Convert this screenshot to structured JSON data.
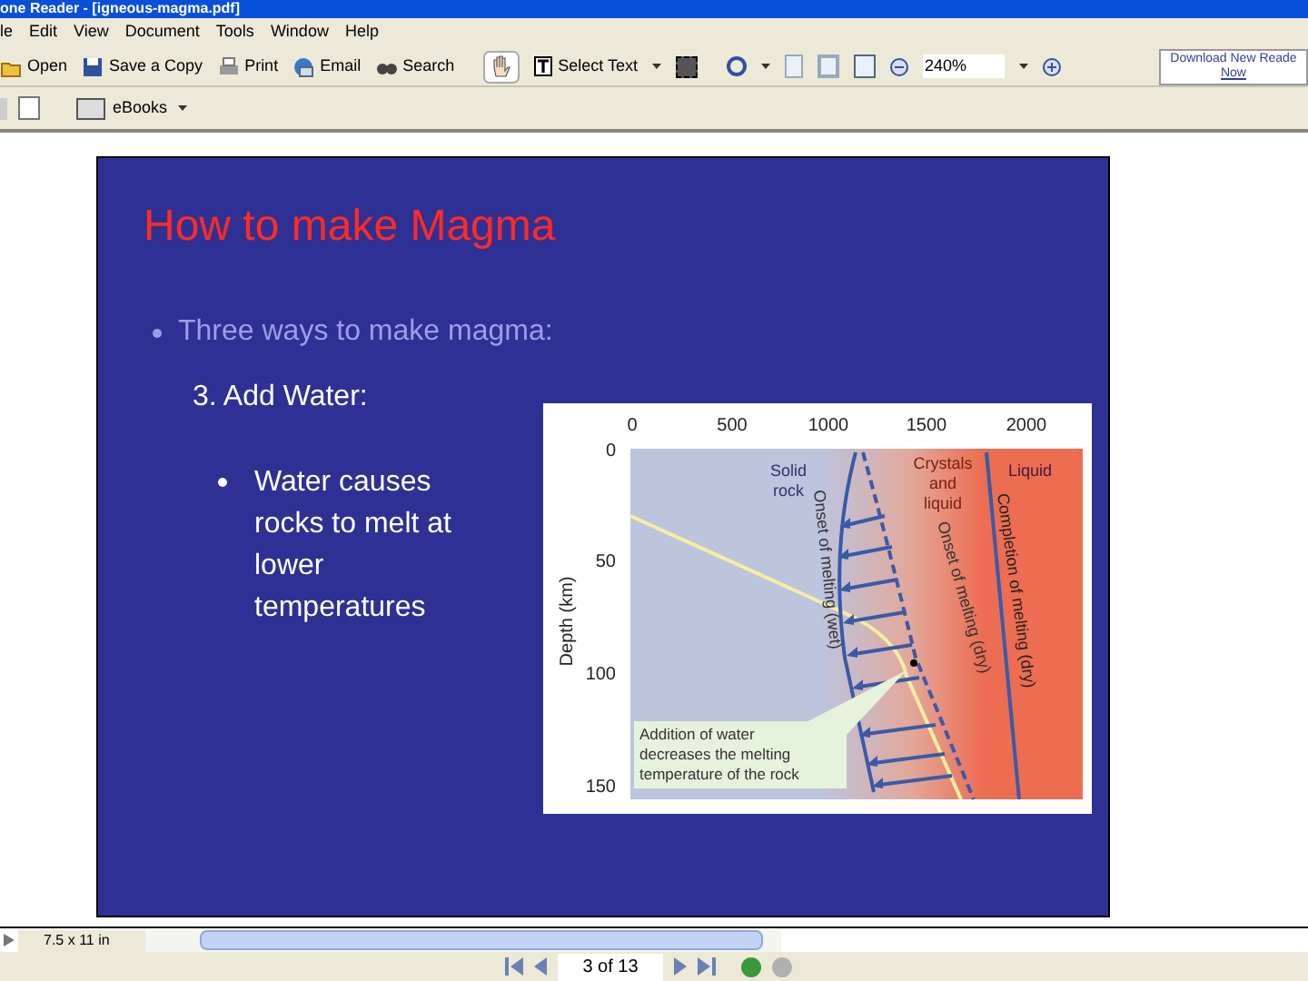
{
  "window": {
    "title": "one Reader - [igneous-magma.pdf]"
  },
  "menu": [
    "le",
    "Edit",
    "View",
    "Document",
    "Tools",
    "Window",
    "Help"
  ],
  "toolbar": {
    "buttons": [
      {
        "kind": "open",
        "label": "Open"
      },
      {
        "kind": "save",
        "label": "Save a Copy"
      },
      {
        "kind": "print",
        "label": "Print"
      },
      {
        "kind": "email",
        "label": "Email"
      },
      {
        "kind": "search",
        "label": "Search"
      }
    ],
    "select_text": "Select Text",
    "zoom": "240%",
    "promo": [
      "Download New Reade",
      "Now"
    ],
    "ebooks": "eBooks"
  },
  "slide": {
    "title": "How to make Magma",
    "bullet": "Three ways to make magma:",
    "subheading": "3. Add Water:",
    "sub_bullet": "Water causes rocks to melt at lower temperatures",
    "figure": {
      "x_ticks": [
        "0",
        "500",
        "1000",
        "1500",
        "2000"
      ],
      "y_ticks": [
        "0",
        "50",
        "100",
        "150"
      ],
      "y_label": "Depth (km)",
      "regions": [
        [
          "Solid",
          "rock"
        ],
        [
          "Crystals",
          "and",
          "liquid"
        ],
        [
          "Liquid"
        ]
      ],
      "curves": [
        "Onset of melting (wet)",
        "Onset of melting (dry)",
        "Completion of melting (dry)"
      ],
      "callout": [
        "Addition of water",
        "decreases the melting",
        "temperature of the rock"
      ]
    }
  },
  "status": {
    "page_size": "7.5 x 11 in",
    "page": "3 of 13"
  }
}
